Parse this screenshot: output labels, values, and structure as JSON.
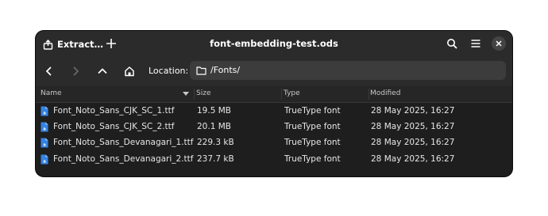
{
  "titlebar": {
    "extract_label": "Extract…",
    "title": "font-embedding-test.ods"
  },
  "toolbar": {
    "location_label": "Location:",
    "location_value": "/Fonts/"
  },
  "columns": {
    "name": "Name",
    "size": "Size",
    "type": "Type",
    "modified": "Modified"
  },
  "files": [
    {
      "name": "Font_Noto_Sans_CJK_SC_1.ttf",
      "size": "19.5 MB",
      "type": "TrueType font",
      "modified": "28 May 2025, 16:27"
    },
    {
      "name": "Font_Noto_Sans_CJK_SC_2.ttf",
      "size": "20.1 MB",
      "type": "TrueType font",
      "modified": "28 May 2025, 16:27"
    },
    {
      "name": "Font_Noto_Sans_Devanagari_1.ttf",
      "size": "229.3 kB",
      "type": "TrueType font",
      "modified": "28 May 2025, 16:27"
    },
    {
      "name": "Font_Noto_Sans_Devanagari_2.ttf",
      "size": "237.7 kB",
      "type": "TrueType font",
      "modified": "28 May 2025, 16:27"
    }
  ],
  "colors": {
    "window_bg": "#1e1e1e",
    "header_bg": "#2b2b2b",
    "location_field_bg": "#3c3c3c",
    "file_icon": "#3584e4"
  }
}
